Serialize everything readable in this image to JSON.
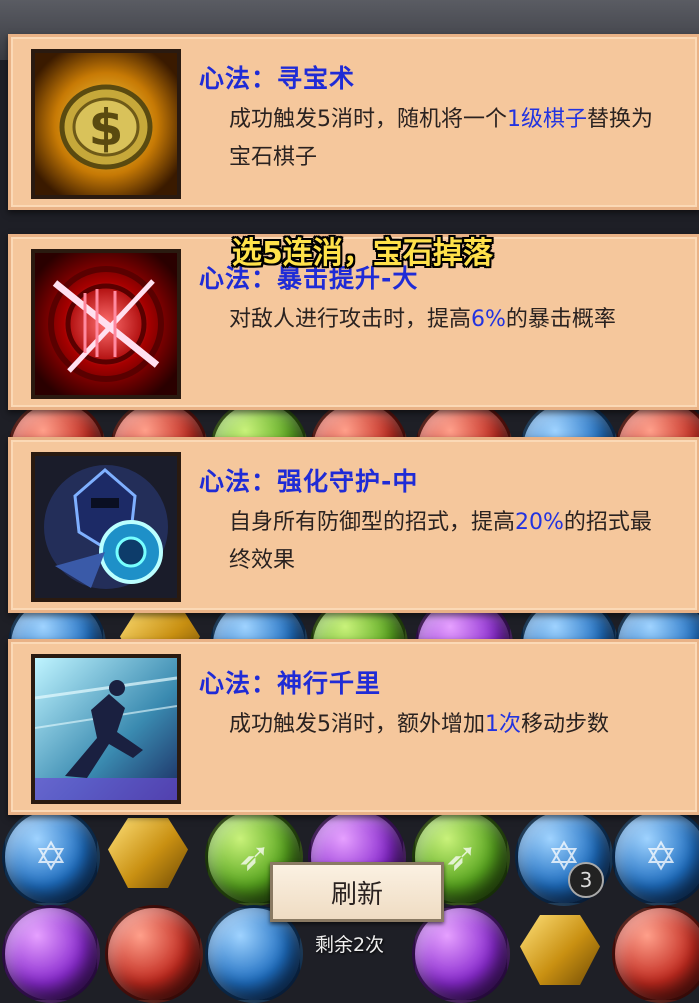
{
  "overlay_caption": "选5连消，宝石掉落",
  "cards": [
    {
      "title": "心法：寻宝术",
      "icon": "gold-coin-icon",
      "desc_parts": [
        "成功触发5消时，随机将一个",
        "1级棋子",
        "替换为宝石棋子"
      ]
    },
    {
      "title": "心法：暴击提升-大",
      "icon": "critical-strike-icon",
      "desc_parts": [
        "对敌人进行攻击时，提高",
        "6%",
        "的暴击概率"
      ]
    },
    {
      "title": "心法：强化守护-中",
      "icon": "armored-knight-icon",
      "desc_parts": [
        "自身所有防御型的招式，提高",
        "20%",
        "的招式最终效果"
      ]
    },
    {
      "title": "心法：神行千里",
      "icon": "dash-runner-icon",
      "desc_parts": [
        "成功触发5消时，额外增加",
        "1次",
        "移动步数"
      ]
    }
  ],
  "board_badge": "3",
  "refresh_label": "刷新",
  "remaining_label": "剩余2次",
  "colors": {
    "card_bg": "#f5c79c",
    "title": "#1f2bd6",
    "highlight": "#2233e0",
    "caption": "#ffe14a"
  }
}
